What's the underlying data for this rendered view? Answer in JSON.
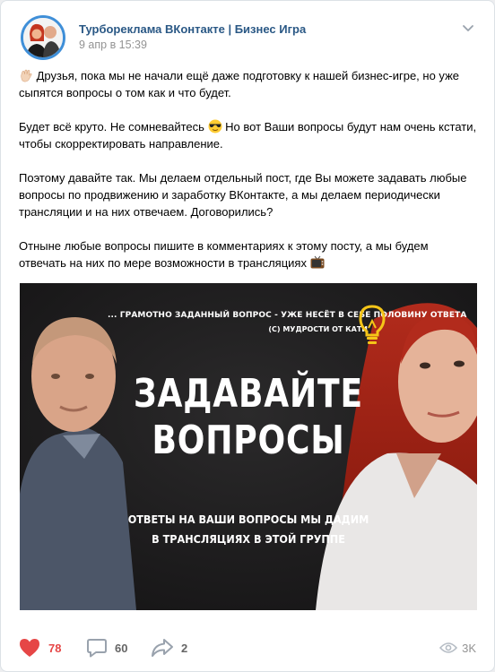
{
  "post": {
    "author": "Турбореклама ВКонтакте | Бизнес Игра",
    "date": "9 апр в 15:39",
    "paragraphs": {
      "p1": "Друзья, пока мы не начали ещё даже подготовку к нашей бизнес-игре, но уже сыпятся вопросы о том как и что будет.",
      "p2a": "Будет всё круто. Не сомневайтесь",
      "p2b": "Но вот Ваши вопросы будут нам очень кстати, чтобы скорректировать направление.",
      "p3": "Поэтому давайте так. Мы делаем отдельный пост, где Вы можете задавать любые вопросы по продвижению и заработку ВКонтакте, а мы делаем периодически трансляции и на них отвечаем. Договорились?",
      "p4": "Отныне любые вопросы пишите в комментариях к этому посту, а мы будем отвечать на них по мере возможности в трансляциях"
    },
    "emoji": {
      "p1": "waving-hand",
      "p2": "sunglasses-face",
      "p4": "television"
    },
    "image": {
      "quote": "... ГРАМОТНО ЗАДАННЫЙ ВОПРОС - УЖЕ НЕСЁТ В СЕБЕ ПОЛОВИНУ ОТВЕТА",
      "quote_sign": "(С) МУДРОСТИ ОТ КАТИ",
      "headline": "ЗАДАВАЙТЕ\nВОПРОСЫ",
      "subline": "ОТВЕТЫ НА ВАШИ ВОПРОСЫ МЫ ДАДИМ\nВ ТРАНСЛЯЦИЯХ В ЭТОЙ ГРУППЕ",
      "bulb_icon": "lightbulb-icon",
      "bulb_color": "#f5c518"
    },
    "stats": {
      "likes": "78",
      "comments": "60",
      "shares": "2",
      "views": "3K"
    }
  },
  "colors": {
    "link": "#2a5885",
    "like_active": "#e64646",
    "muted": "#939393",
    "avatar_ring": "#3f8fd8"
  }
}
